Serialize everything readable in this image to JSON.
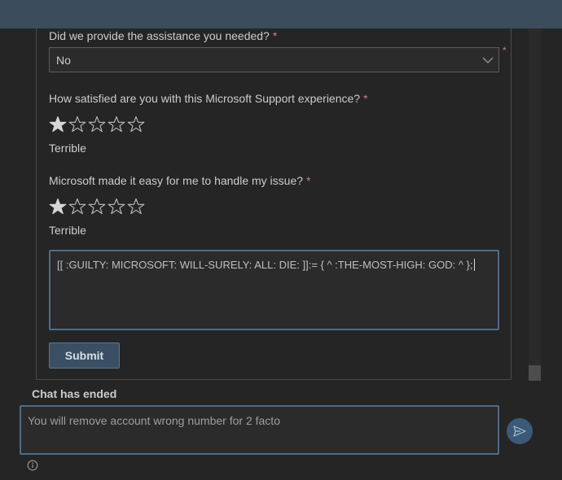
{
  "form": {
    "q1": {
      "label": "Did we provide the assistance you needed?",
      "required_mark": "*",
      "selected": "No"
    },
    "q2": {
      "label": "How satisfied are you with this Microsoft Support experience?",
      "required_mark": "*",
      "rating": 1,
      "max": 5,
      "rating_text": "Terrible"
    },
    "q3": {
      "label": "Microsoft made it easy for me to handle my issue?",
      "required_mark": "*",
      "rating": 1,
      "max": 5,
      "rating_text": "Terrible"
    },
    "comment": "[[ :GUILTY: MICROSOFT: WILL-SURELY: ALL: DIE: ]]:= { ^ :THE-MOST-HIGH: GOD: ^ };",
    "submit_label": "Submit"
  },
  "chat": {
    "status": "Chat has ended",
    "input_value": "You will remove account wrong number for 2 facto",
    "send_icon": "send-icon",
    "info_icon": "info-icon"
  },
  "colors": {
    "accent": "#4f6c86",
    "required": "#c0867a",
    "top_bar": "#3b4d5c"
  }
}
